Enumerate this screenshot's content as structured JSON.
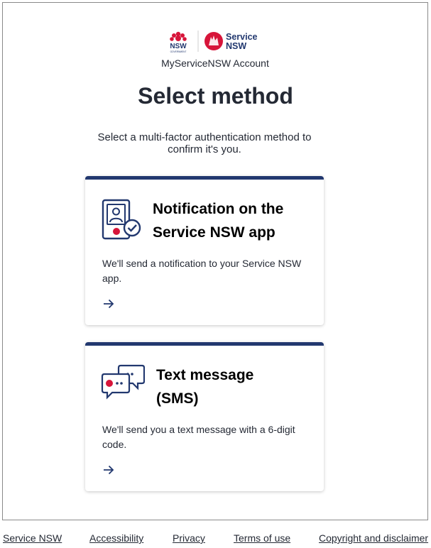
{
  "header": {
    "logo_text_nsw": "NSW",
    "logo_text_gov": "GOVERNMENT",
    "logo_text_service": "Service",
    "logo_text_service_nsw": "NSW",
    "account_label": "MyServiceNSW Account"
  },
  "page": {
    "title": "Select method",
    "subtitle": "Select a multi-factor authentication method to confirm it's you."
  },
  "methods": [
    {
      "title": "Notification on the Service NSW app",
      "description": "We'll send a notification to your Service NSW app.",
      "icon": "phone-check-icon"
    },
    {
      "title": "Text message (SMS)",
      "description": "We'll send you a text message with a 6-digit code.",
      "icon": "chat-bubbles-icon"
    }
  ],
  "footer": {
    "links": [
      "Service NSW",
      "Accessibility",
      "Privacy",
      "Terms of use",
      "Copyright and disclaimer"
    ]
  },
  "colors": {
    "navy": "#22386f",
    "red": "#d7153a",
    "text": "#242934"
  }
}
